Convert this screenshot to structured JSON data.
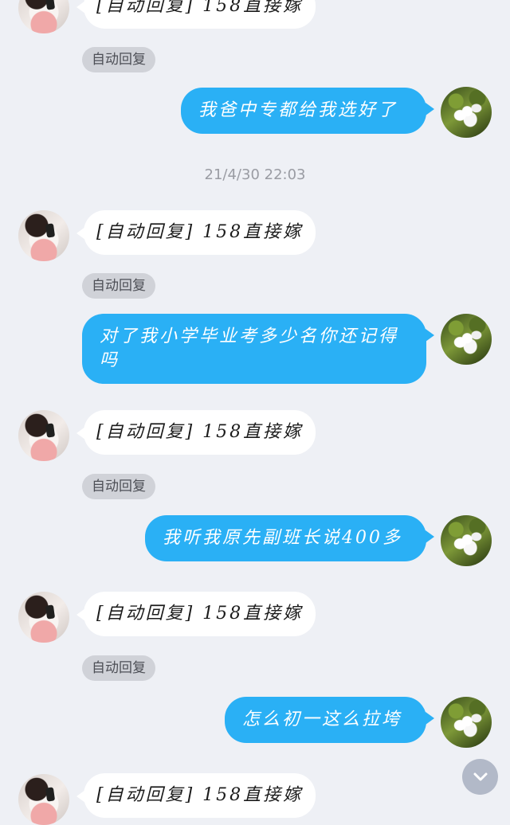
{
  "auto_reply_text": "[自动回复] 158直接嫁",
  "auto_reply_badge": "自动回复",
  "timestamp": "21/4/30 22:03",
  "outgoing_messages": [
    "我爸中专都给我选好了",
    "对了我小学毕业考多少名你还记得吗",
    "我听我原先副班长说400多",
    "怎么初一这么拉垮"
  ],
  "icons": {
    "scroll_down": "chevron-down-icon",
    "contact_avatar": "girl-avatar",
    "my_avatar": "white-flower-avatar"
  },
  "colors": {
    "background": "#eef0f5",
    "outgoing_bubble": "#2ab0f5",
    "incoming_bubble": "#ffffff",
    "auto_badge": "#d0d2d8"
  }
}
